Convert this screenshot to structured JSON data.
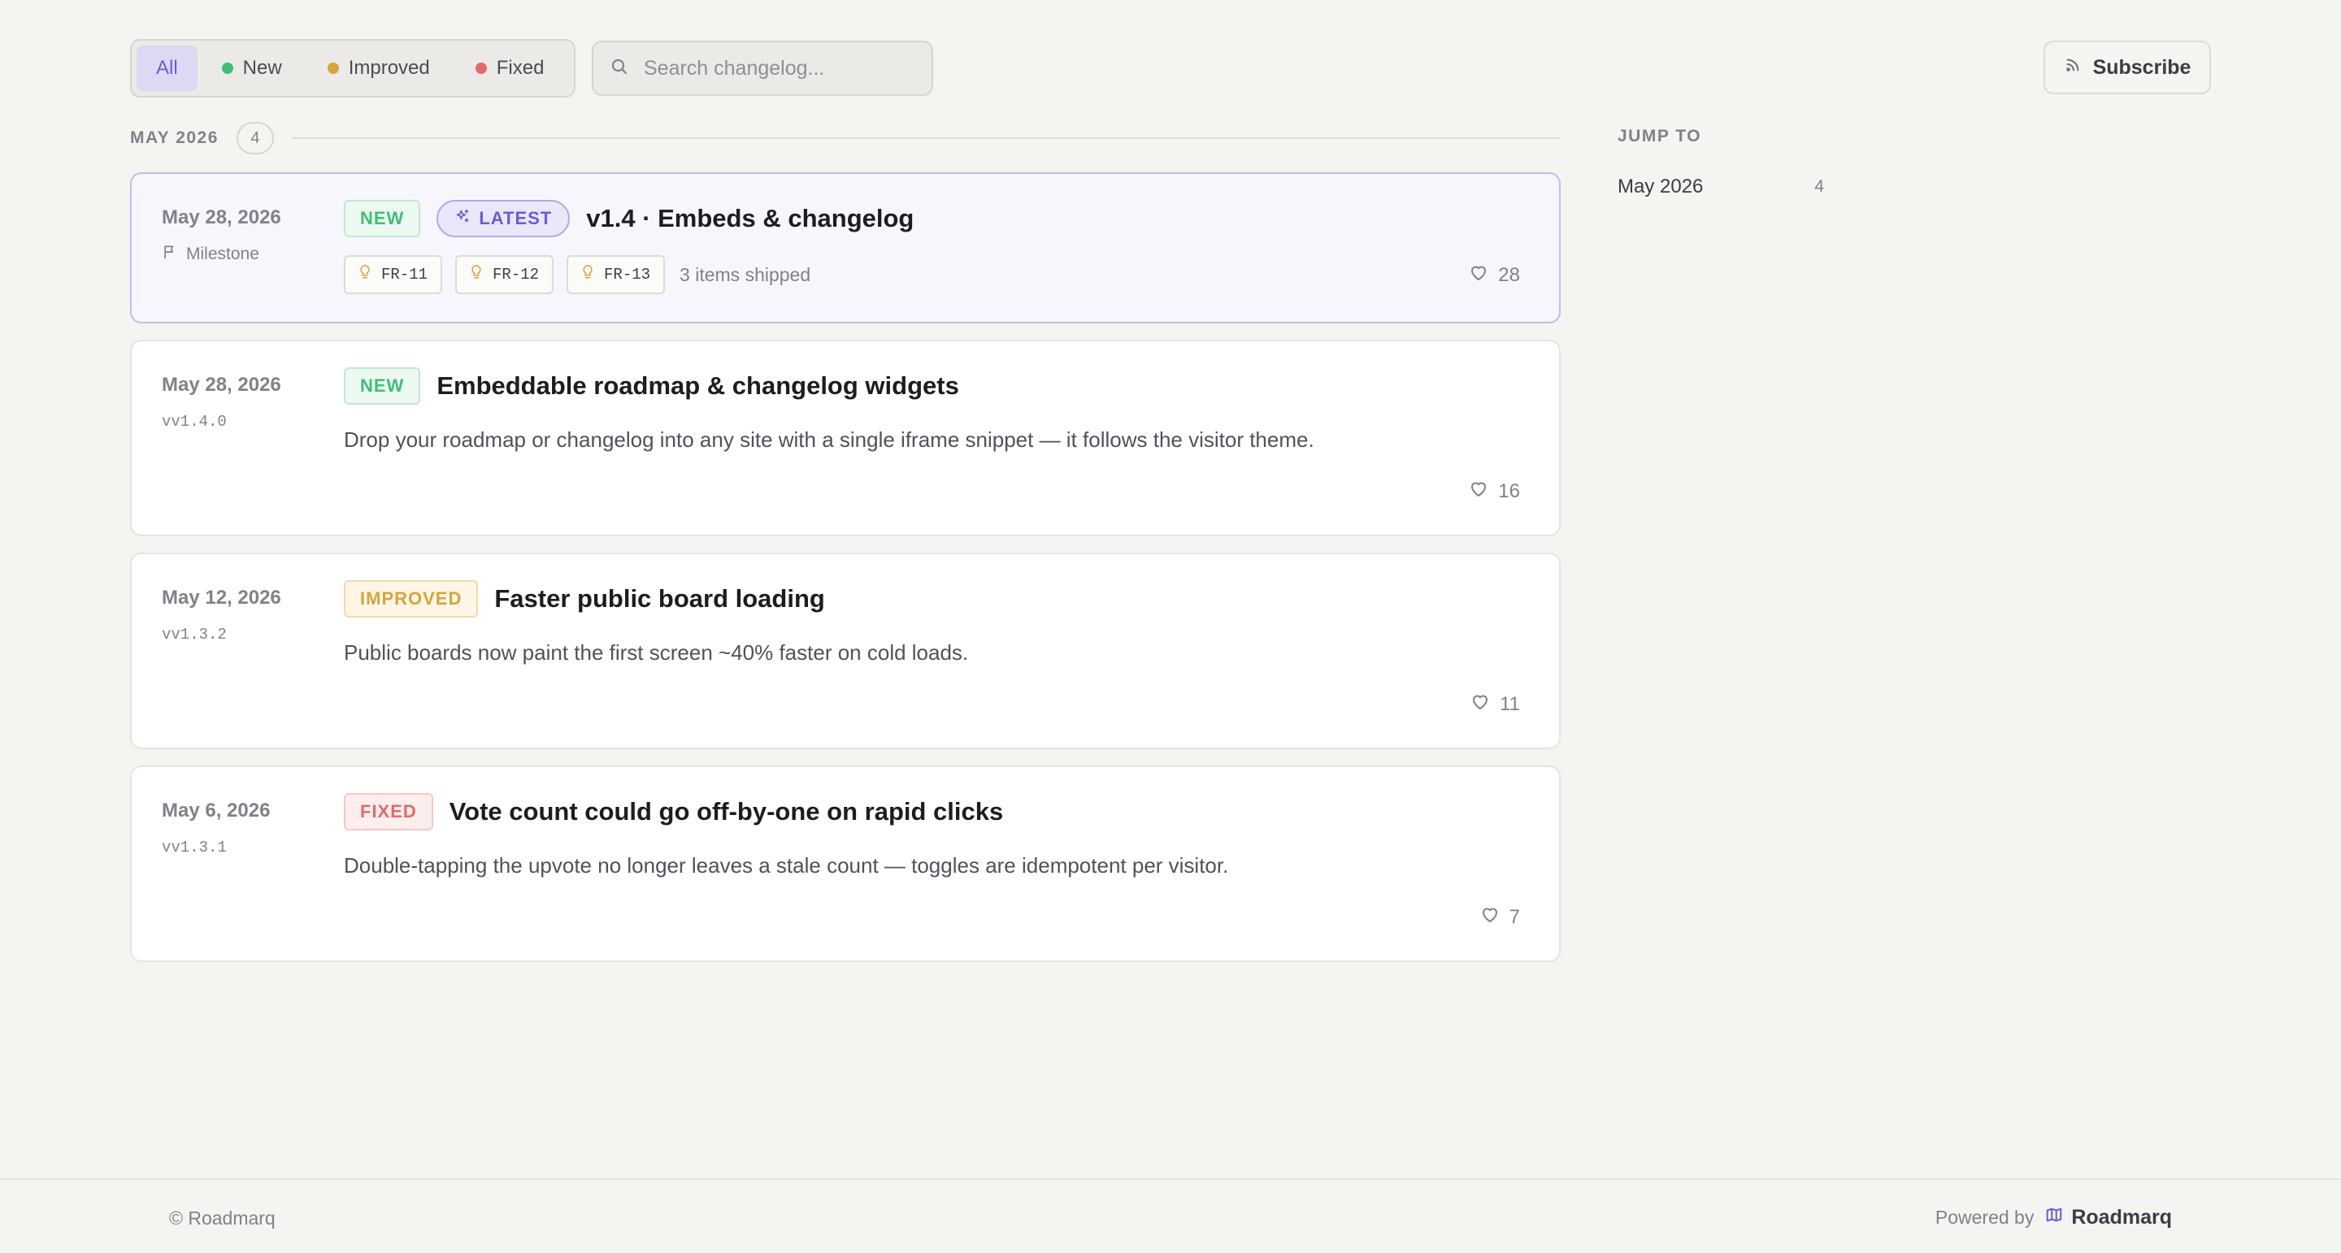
{
  "filters": {
    "all": "All",
    "new": "New",
    "improved": "Improved",
    "fixed": "Fixed"
  },
  "search": {
    "placeholder": "Search changelog..."
  },
  "subscribe": {
    "label": "Subscribe"
  },
  "month": {
    "label": "MAY 2026",
    "count": "4"
  },
  "entries": [
    {
      "date": "May 28, 2026",
      "sub": "Milestone",
      "badge": "NEW",
      "latest": "LATEST",
      "title": "v1.4 · Embeds & changelog",
      "chips": [
        "FR-11",
        "FR-12",
        "FR-13"
      ],
      "shipped": "3 items shipped",
      "likes": "28"
    },
    {
      "date": "May 28, 2026",
      "sub": "vv1.4.0",
      "badge": "NEW",
      "title": "Embeddable roadmap & changelog widgets",
      "desc": "Drop your roadmap or changelog into any site with a single iframe snippet — it follows the visitor theme.",
      "likes": "16"
    },
    {
      "date": "May 12, 2026",
      "sub": "vv1.3.2",
      "badge": "IMPROVED",
      "title": "Faster public board loading",
      "desc": "Public boards now paint the first screen ~40% faster on cold loads.",
      "likes": "11"
    },
    {
      "date": "May 6, 2026",
      "sub": "vv1.3.1",
      "badge": "FIXED",
      "title": "Vote count could go off-by-one on rapid clicks",
      "desc": "Double-tapping the upvote no longer leaves a stale count — toggles are idempotent per visitor.",
      "likes": "7"
    }
  ],
  "jump": {
    "title": "JUMP TO",
    "items": [
      {
        "label": "May 2026",
        "count": "4"
      }
    ]
  },
  "footer": {
    "copyright": "© Roadmarq",
    "powered": "Powered by",
    "brand": "Roadmarq"
  },
  "colors": {
    "accent": "#6b5cd6",
    "new": "#3fbf78",
    "improved": "#d6a43b",
    "fixed": "#e36a6a",
    "background": "#f5f4f1"
  },
  "icons": {
    "search": "search-icon",
    "subscribe": "rss-icon",
    "milestone": "flag-icon",
    "latest": "sparkles-icon",
    "chip": "lightbulb-icon",
    "likes": "heart-icon",
    "brand": "map-icon"
  }
}
